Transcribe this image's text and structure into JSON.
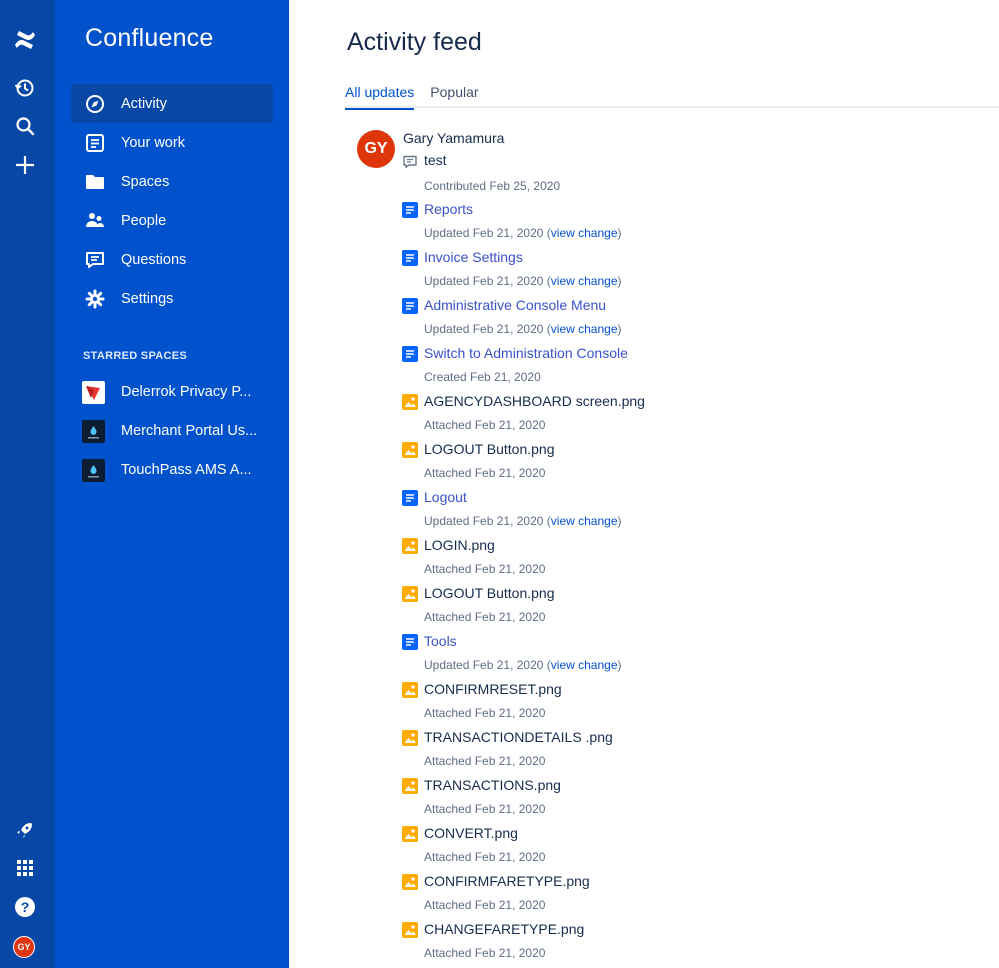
{
  "app": {
    "name": "Confluence"
  },
  "nav": {
    "items": [
      {
        "label": "Activity",
        "icon": "compass-icon",
        "active": true
      },
      {
        "label": "Your work",
        "icon": "document-icon",
        "active": false
      },
      {
        "label": "Spaces",
        "icon": "folder-icon",
        "active": false
      },
      {
        "label": "People",
        "icon": "people-icon",
        "active": false
      },
      {
        "label": "Questions",
        "icon": "questions-icon",
        "active": false
      },
      {
        "label": "Settings",
        "icon": "gear-icon",
        "active": false
      }
    ],
    "starred_heading": "STARRED SPACES",
    "starred": [
      {
        "label": "Delerrok Privacy P..."
      },
      {
        "label": "Merchant Portal Us..."
      },
      {
        "label": "TouchPass AMS A..."
      }
    ]
  },
  "user": {
    "initials": "GY",
    "name": "Gary Yamamura"
  },
  "main": {
    "title": "Activity feed",
    "tabs": [
      {
        "label": "All updates",
        "active": true
      },
      {
        "label": "Popular",
        "active": false
      }
    ]
  },
  "feed": [
    {
      "type": "comment",
      "title": "test",
      "action": "Contributed Feb 25, 2020",
      "view_change": ""
    },
    {
      "type": "page",
      "title": "Reports",
      "action": "Updated Feb 21, 2020",
      "view_change": "view change"
    },
    {
      "type": "page",
      "title": "Invoice Settings",
      "action": "Updated Feb 21, 2020",
      "view_change": "view change"
    },
    {
      "type": "page",
      "title": "Administrative Console Menu",
      "action": "Updated Feb 21, 2020",
      "view_change": "view change"
    },
    {
      "type": "page",
      "title": "Switch to Administration Console",
      "action": "Created Feb 21, 2020",
      "view_change": ""
    },
    {
      "type": "image",
      "title": "AGENCYDASHBOARD screen.png",
      "action": "Attached Feb 21, 2020",
      "view_change": ""
    },
    {
      "type": "image",
      "title": "LOGOUT Button.png",
      "action": "Attached Feb 21, 2020",
      "view_change": ""
    },
    {
      "type": "page",
      "title": "Logout",
      "action": "Updated Feb 21, 2020",
      "view_change": "view change"
    },
    {
      "type": "image",
      "title": "LOGIN.png",
      "action": "Attached Feb 21, 2020",
      "view_change": ""
    },
    {
      "type": "image",
      "title": "LOGOUT Button.png",
      "action": "Attached Feb 21, 2020",
      "view_change": ""
    },
    {
      "type": "page",
      "title": "Tools",
      "action": "Updated Feb 21, 2020",
      "view_change": "view change"
    },
    {
      "type": "image",
      "title": "CONFIRMRESET.png",
      "action": "Attached Feb 21, 2020",
      "view_change": ""
    },
    {
      "type": "image",
      "title": "TRANSACTIONDETAILS .png",
      "action": "Attached Feb 21, 2020",
      "view_change": ""
    },
    {
      "type": "image",
      "title": "TRANSACTIONS.png",
      "action": "Attached Feb 21, 2020",
      "view_change": ""
    },
    {
      "type": "image",
      "title": "CONVERT.png",
      "action": "Attached Feb 21, 2020",
      "view_change": ""
    },
    {
      "type": "image",
      "title": "CONFIRMFARETYPE.png",
      "action": "Attached Feb 21, 2020",
      "view_change": ""
    },
    {
      "type": "image",
      "title": "CHANGEFARETYPE.png",
      "action": "Attached Feb 21, 2020",
      "view_change": ""
    }
  ],
  "colors": {
    "rail": "#0747A6",
    "sidebar": "#0052CC",
    "accent": "#0052CC",
    "avatar": "#DE350B",
    "image_icon": "#FFAB00"
  }
}
